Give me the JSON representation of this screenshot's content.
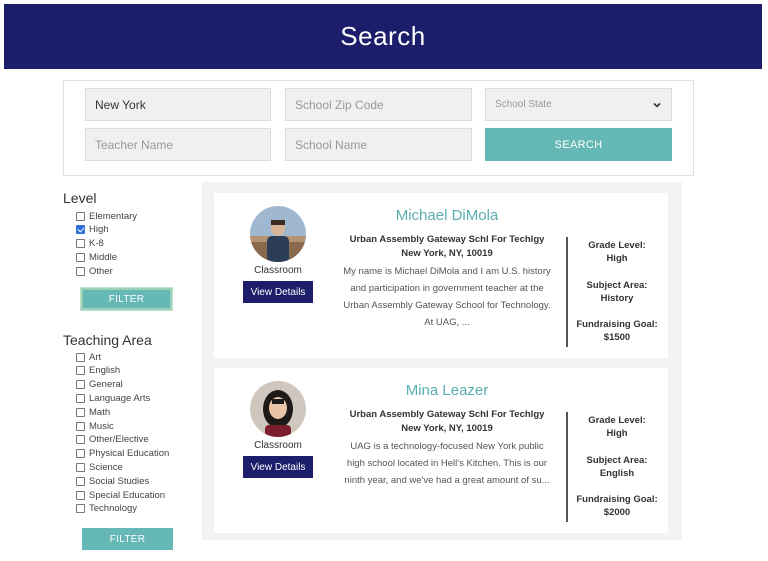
{
  "header": {
    "title": "Search"
  },
  "search": {
    "city_value": "New York",
    "zip_placeholder": "School Zip Code",
    "state_placeholder": "School State",
    "teacher_placeholder": "Teacher Name",
    "school_placeholder": "School Name",
    "search_label": "SEARCH"
  },
  "level": {
    "title": "Level",
    "options": [
      {
        "label": "Elementary",
        "checked": false
      },
      {
        "label": "High",
        "checked": true
      },
      {
        "label": "K-8",
        "checked": false
      },
      {
        "label": "Middle",
        "checked": false
      },
      {
        "label": "Other",
        "checked": false
      }
    ],
    "filter_label": "FILTER"
  },
  "teaching_area": {
    "title": "Teaching Area",
    "options": [
      {
        "label": "Art",
        "checked": false
      },
      {
        "label": "English",
        "checked": false
      },
      {
        "label": "General",
        "checked": false
      },
      {
        "label": "Language Arts",
        "checked": false
      },
      {
        "label": "Math",
        "checked": false
      },
      {
        "label": "Music",
        "checked": false
      },
      {
        "label": "Other/Elective",
        "checked": false
      },
      {
        "label": "Physical Education",
        "checked": false
      },
      {
        "label": "Science",
        "checked": false
      },
      {
        "label": "Social Studies",
        "checked": false
      },
      {
        "label": "Special Education",
        "checked": false
      },
      {
        "label": "Technology",
        "checked": false
      }
    ],
    "filter_label": "FILTER"
  },
  "results": [
    {
      "name": "Michael DiMola",
      "classroom_label": "Classroom",
      "view_label": "View Details",
      "school": "Urban Assembly Gateway Schl For Techlgy",
      "location": "New York, NY, 10019",
      "description": "My name is Michael DiMola and I am U.S. history and participation in government teacher at the Urban Assembly Gateway School for Technology. At UAG, ...",
      "grade_label": "Grade Level:",
      "grade_value": "High",
      "subject_label": "Subject Area:",
      "subject_value": "History",
      "goal_label": "Fundraising Goal:",
      "goal_value": "$1500"
    },
    {
      "name": "Mina Leazer",
      "classroom_label": "Classroom",
      "view_label": "View Details",
      "school": "Urban Assembly Gateway Schl For Techlgy",
      "location": "New York, NY, 10019",
      "description": "UAG is a technology-focused New York public high school located in Hell's Kitchen. This is our ninth year, and we've had a great amount of su...",
      "grade_label": "Grade Level:",
      "grade_value": "High",
      "subject_label": "Subject Area:",
      "subject_value": "English",
      "goal_label": "Fundraising Goal:",
      "goal_value": "$2000"
    }
  ]
}
